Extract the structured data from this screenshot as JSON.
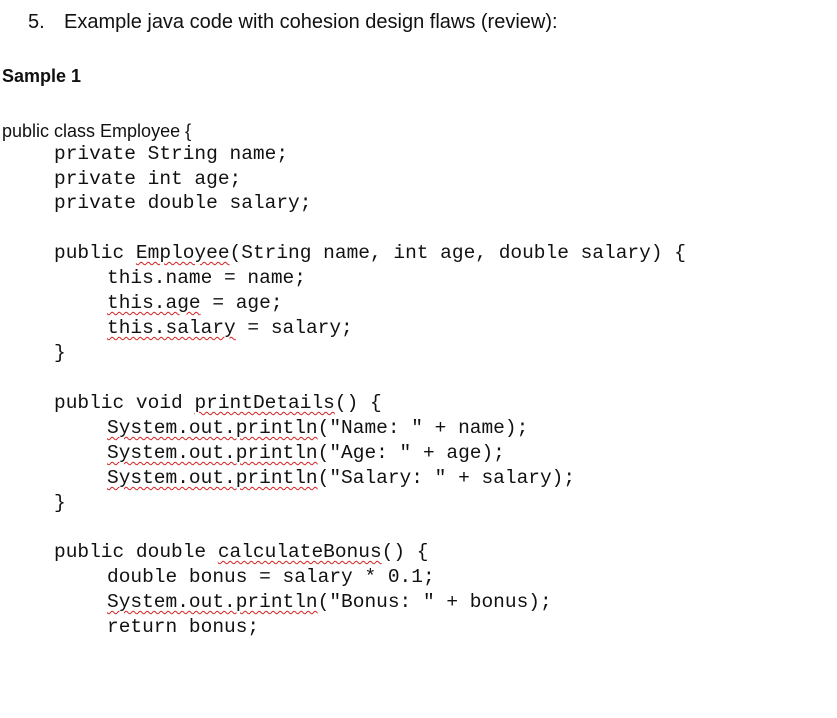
{
  "heading": {
    "number": "5.",
    "text": "Example java code with cohesion design flaws (review):"
  },
  "sample_label": "Sample 1",
  "class_declaration": "public class Employee {",
  "code": {
    "field_name": "private String name;",
    "field_age": "private int age;",
    "field_salary": "private double salary;",
    "constructor_pre": "public ",
    "constructor_name": "Employee",
    "constructor_post": "(String name, int age, double salary) {",
    "ctor_name_assign": "this.name = name;",
    "ctor_age_lhs": "this.age",
    "ctor_age_rhs": " = age;",
    "ctor_salary_lhs": "this.salary",
    "ctor_salary_rhs": " = salary;",
    "close_brace_1": "}",
    "print_details_pre": "public void ",
    "print_details_name": "printDetails",
    "print_details_post": "() {",
    "println_call": "System.out.println",
    "println_name_args": "(\"Name: \" + name);",
    "println_age_args": "(\"Age: \" + age);",
    "println_salary_args": "(\"Salary: \" + salary);",
    "close_brace_2": "}",
    "calc_bonus_pre": "public double ",
    "calc_bonus_name": "calculateBonus",
    "calc_bonus_post": "() {",
    "bonus_calc": "double bonus = salary * 0.1;",
    "println_bonus_args": "(\"Bonus: \" + bonus);",
    "return_bonus": "return bonus;"
  },
  "colors": {
    "text": "#111111",
    "spellcheck_underline": "#d42020"
  }
}
